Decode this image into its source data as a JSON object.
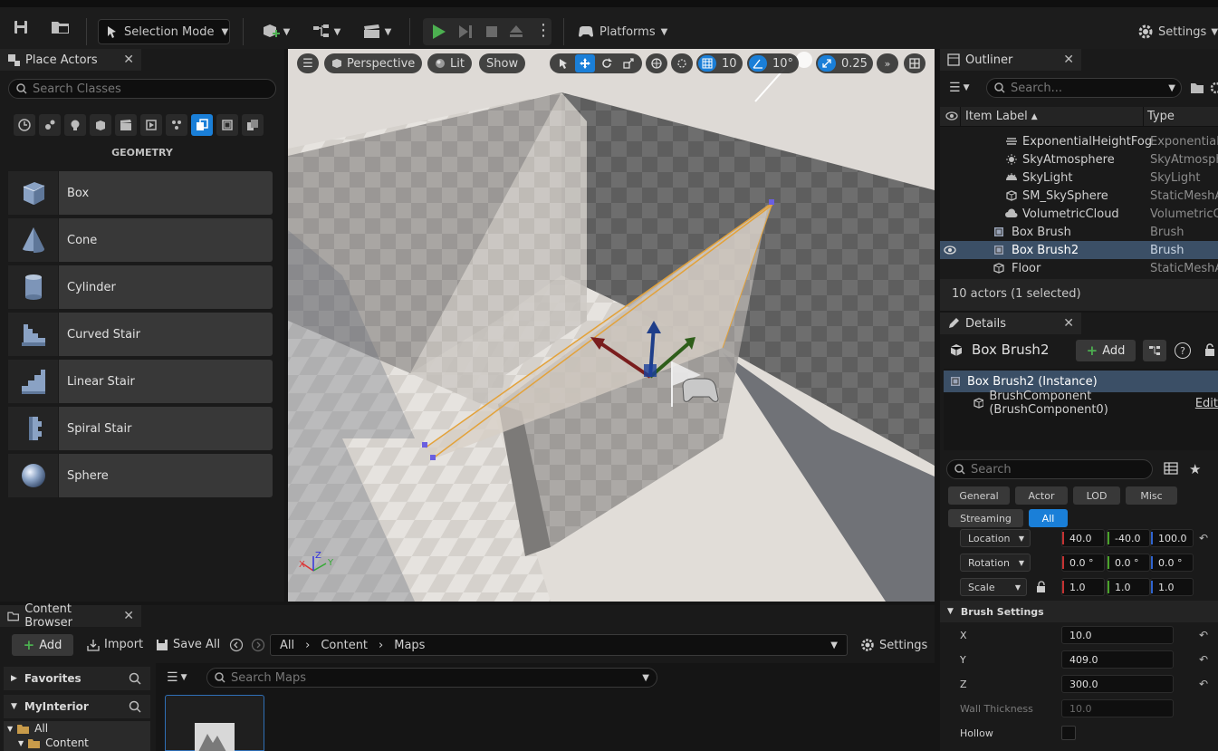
{
  "toolbar": {
    "selection_mode": "Selection Mode",
    "platforms": "Platforms",
    "settings": "Settings"
  },
  "place_actors": {
    "tab_title": "Place Actors",
    "search_placeholder": "Search Classes",
    "category_title": "GEOMETRY",
    "items": [
      {
        "label": "Box",
        "icon": "box-icon"
      },
      {
        "label": "Cone",
        "icon": "cone-icon"
      },
      {
        "label": "Cylinder",
        "icon": "cylinder-icon"
      },
      {
        "label": "Curved Stair",
        "icon": "curved-stair-icon"
      },
      {
        "label": "Linear Stair",
        "icon": "linear-stair-icon"
      },
      {
        "label": "Spiral Stair",
        "icon": "spiral-stair-icon"
      },
      {
        "label": "Sphere",
        "icon": "sphere-icon"
      }
    ]
  },
  "viewport": {
    "perspective": "Perspective",
    "lit": "Lit",
    "show": "Show",
    "grid_snap": "10",
    "rot_snap": "10°",
    "scale_snap": "0.25"
  },
  "outliner": {
    "tab_title": "Outliner",
    "search_placeholder": "Search...",
    "col_label": "Item Label",
    "col_type": "Type",
    "rows": [
      {
        "label": "ExponentialHeightFog",
        "type": "ExponentialH"
      },
      {
        "label": "SkyAtmosphere",
        "type": "SkyAtmosph"
      },
      {
        "label": "SkyLight",
        "type": "SkyLight"
      },
      {
        "label": "SM_SkySphere",
        "type": "StaticMeshA"
      },
      {
        "label": "VolumetricCloud",
        "type": "VolumetricCl"
      },
      {
        "label": "Box Brush",
        "type": "Brush"
      },
      {
        "label": "Box Brush2",
        "type": "Brush"
      },
      {
        "label": "Floor",
        "type": "StaticMeshA"
      }
    ],
    "status": "10 actors (1 selected)"
  },
  "details": {
    "tab_title": "Details",
    "actor_name": "Box Brush2",
    "add_label": "Add",
    "instance_label": "Box Brush2 (Instance)",
    "component_label": "BrushComponent (BrushComponent0)",
    "edit_label": "Edit",
    "search_placeholder": "Search",
    "filters": [
      "General",
      "Actor",
      "LOD",
      "Misc",
      "Streaming",
      "All"
    ],
    "location": {
      "label": "Location",
      "x": "40.0",
      "y": "-40.0",
      "z": "100.0"
    },
    "rotation": {
      "label": "Rotation",
      "x": "0.0 °",
      "y": "0.0 °",
      "z": "0.0 °"
    },
    "scale": {
      "label": "Scale",
      "x": "1.0",
      "y": "1.0",
      "z": "1.0"
    },
    "brush_settings_title": "Brush Settings",
    "brush_x": {
      "label": "X",
      "value": "10.0"
    },
    "brush_y": {
      "label": "Y",
      "value": "409.0"
    },
    "brush_z": {
      "label": "Z",
      "value": "300.0"
    },
    "wall_thickness": {
      "label": "Wall Thickness",
      "value": "10.0"
    },
    "hollow": {
      "label": "Hollow"
    }
  },
  "content_browser": {
    "tab_title": "Content Browser",
    "add": "Add",
    "import": "Import",
    "save_all": "Save All",
    "path": [
      "All",
      "Content",
      "Maps"
    ],
    "settings": "Settings",
    "favorites": "Favorites",
    "project": "MyInterior",
    "search_placeholder": "Search Maps",
    "tree": [
      "All",
      "Content"
    ]
  }
}
